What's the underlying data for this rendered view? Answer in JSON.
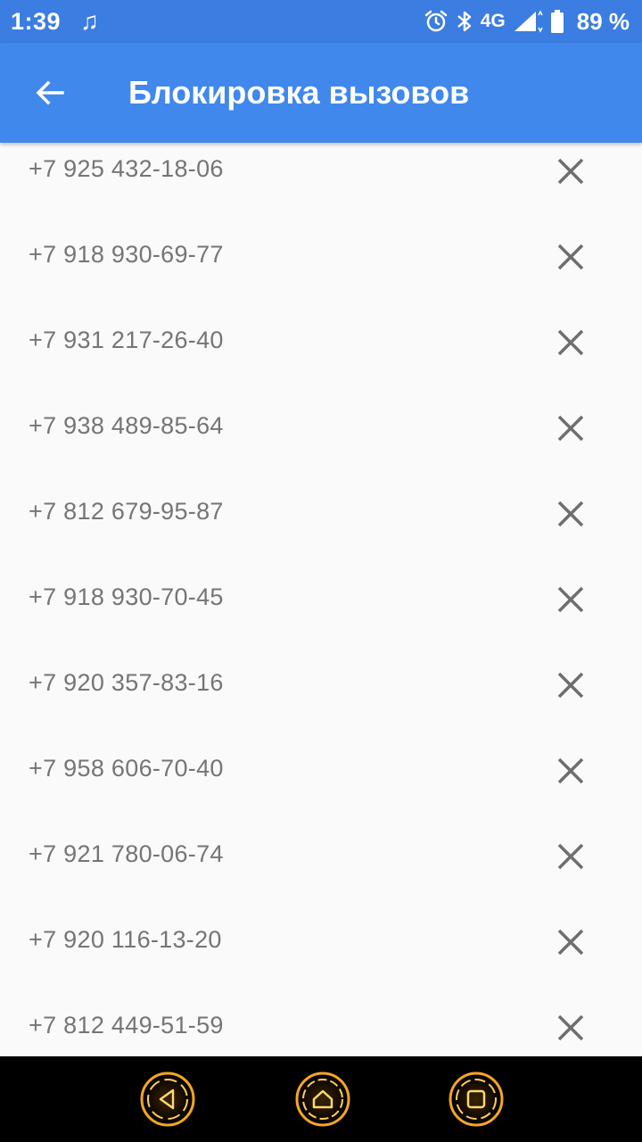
{
  "status_bar": {
    "time": "1:39",
    "network": "4G",
    "battery": "89 %"
  },
  "app_bar": {
    "title": "Блокировка вызовов"
  },
  "blocked_numbers": [
    "+7 925 432-18-06",
    "+7 918 930-69-77",
    "+7 931 217-26-40",
    "+7 938 489-85-64",
    "+7 812 679-95-87",
    "+7 918 930-70-45",
    "+7 920 357-83-16",
    "+7 958 606-70-40",
    "+7 921 780-06-74",
    "+7 920 116-13-20",
    "+7 812 449-51-59"
  ],
  "icons": {
    "back": "arrow-left-icon",
    "remove": "close-icon",
    "nav_back": "triangle-left-icon",
    "nav_home": "home-icon",
    "nav_recents": "square-icon"
  },
  "colors": {
    "status_bar": "#3b7de0",
    "app_bar": "#4088ec",
    "list_background": "#fafafa",
    "phone_text": "#757575",
    "nav_accent": "#f5a623"
  }
}
